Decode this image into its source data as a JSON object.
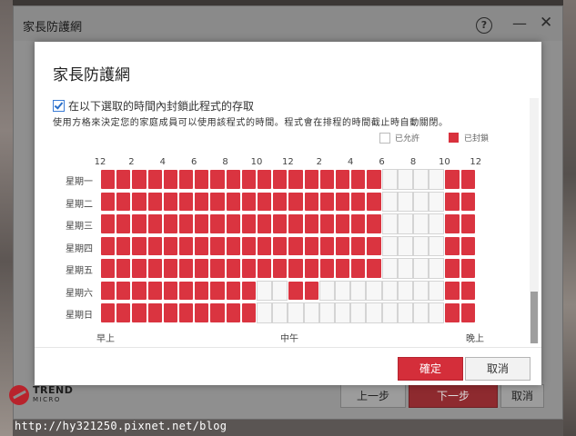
{
  "window": {
    "title": "家長防護網",
    "help_glyph": "?",
    "minimize_glyph": "—",
    "close_glyph": "✕"
  },
  "brand": {
    "line1": "TREND",
    "line2": "MICRO",
    "logo_color": "#b8232c"
  },
  "footer": {
    "prev_label": "上一步",
    "next_label": "下一步",
    "cancel_label": "取消"
  },
  "watermark": "http://hy321250.pixnet.net/blog",
  "dialog": {
    "title": "家長防護網",
    "checkbox_label": "在以下選取的時間內封鎖此程式的存取",
    "checkbox_checked": true,
    "description": "使用方格來決定您的家庭成員可以使用該程式的時間。程式會在排程的時間截止時自動關閉。",
    "legend": {
      "allowed": "已允許",
      "blocked": "已封鎖"
    },
    "hour_labels": [
      "12",
      "2",
      "4",
      "6",
      "8",
      "10",
      "12",
      "2",
      "4",
      "6",
      "8",
      "10",
      "12"
    ],
    "period_labels": [
      "早上",
      "中午",
      "晚上"
    ],
    "ok_label": "確定",
    "cancel_label": "取消",
    "blocked_color": "#da3440"
  },
  "schedule": {
    "days": [
      "星期一",
      "星期二",
      "星期三",
      "星期四",
      "星期五",
      "星期六",
      "星期日"
    ],
    "blocked_hours": [
      [
        0,
        1,
        2,
        3,
        4,
        5,
        6,
        7,
        8,
        9,
        10,
        11,
        12,
        13,
        14,
        15,
        16,
        17,
        22,
        23
      ],
      [
        0,
        1,
        2,
        3,
        4,
        5,
        6,
        7,
        8,
        9,
        10,
        11,
        12,
        13,
        14,
        15,
        16,
        17,
        22,
        23
      ],
      [
        0,
        1,
        2,
        3,
        4,
        5,
        6,
        7,
        8,
        9,
        10,
        11,
        12,
        13,
        14,
        15,
        16,
        17,
        22,
        23
      ],
      [
        0,
        1,
        2,
        3,
        4,
        5,
        6,
        7,
        8,
        9,
        10,
        11,
        12,
        13,
        14,
        15,
        16,
        17,
        22,
        23
      ],
      [
        0,
        1,
        2,
        3,
        4,
        5,
        6,
        7,
        8,
        9,
        10,
        11,
        12,
        13,
        14,
        15,
        16,
        17,
        22,
        23
      ],
      [
        0,
        1,
        2,
        3,
        4,
        5,
        6,
        7,
        8,
        9,
        12,
        13,
        22,
        23
      ],
      [
        0,
        1,
        2,
        3,
        4,
        5,
        6,
        7,
        8,
        9,
        22,
        23
      ]
    ]
  }
}
